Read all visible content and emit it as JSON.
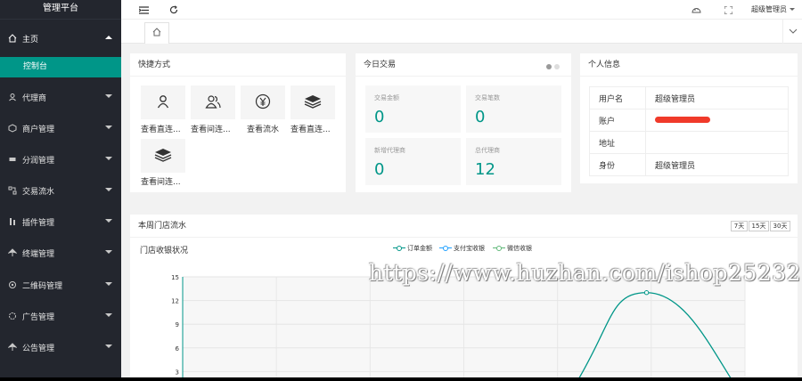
{
  "brand": "管理平台",
  "sidebar": {
    "items": [
      {
        "label": "主页",
        "icon": "home-icon"
      },
      {
        "label": "代理商",
        "icon": "user-icon"
      },
      {
        "label": "商户管理",
        "icon": "shop-icon"
      },
      {
        "label": "分润管理",
        "icon": "chat-icon"
      },
      {
        "label": "交易流水",
        "icon": "flow-icon"
      },
      {
        "label": "插件管理",
        "icon": "plugin-icon"
      },
      {
        "label": "终端管理",
        "icon": "terminal-icon"
      },
      {
        "label": "二维码管理",
        "icon": "qrcode-icon"
      },
      {
        "label": "广告管理",
        "icon": "ad-icon"
      },
      {
        "label": "公告管理",
        "icon": "notice-icon"
      }
    ],
    "active_sub": "控制台"
  },
  "header": {
    "user_name": "超级管理员"
  },
  "quick": {
    "title": "快捷方式",
    "items": [
      {
        "label": "查看直连...",
        "icon": "person-icon"
      },
      {
        "label": "查看间连...",
        "icon": "people-icon"
      },
      {
        "label": "查看流水",
        "icon": "yen-icon"
      },
      {
        "label": "查看直连...",
        "icon": "layers-icon"
      },
      {
        "label": "查看间连...",
        "icon": "layers-icon"
      }
    ]
  },
  "today": {
    "title": "今日交易",
    "stats": [
      {
        "label": "交易金额",
        "value": "0"
      },
      {
        "label": "交易笔数",
        "value": "0"
      },
      {
        "label": "新增代理商",
        "value": "0"
      },
      {
        "label": "总代理商",
        "value": "12"
      }
    ]
  },
  "profile": {
    "title": "个人信息",
    "rows": [
      {
        "key": "用户名",
        "value": "超级管理员"
      },
      {
        "key": "账户",
        "value": ""
      },
      {
        "key": "地址",
        "value": ""
      },
      {
        "key": "身份",
        "value": "超级管理员"
      }
    ]
  },
  "weekly": {
    "title": "本周门店流水",
    "subtitle": "门店收银状况",
    "ranges": [
      "7天",
      "15天",
      "30天"
    ]
  },
  "watermark": "https://www.huzhan.com/ishop25232",
  "colors": {
    "accent": "#009688",
    "sidebar_bg": "#23262e",
    "series_order": "#009688",
    "series_alipay": "#1e9fff",
    "series_wechat": "#5fb878"
  },
  "chart_data": {
    "type": "line",
    "title": "",
    "ylim": [
      0,
      15
    ],
    "yticks": [
      3,
      6,
      9,
      12,
      15
    ],
    "grid": true,
    "legend_position": "top-center",
    "series": [
      {
        "name": "订单金额",
        "color": "#009688"
      },
      {
        "name": "支付宝收银",
        "color": "#1e9fff"
      },
      {
        "name": "微信收银",
        "color": "#5fb878"
      }
    ],
    "peak_value": 13
  }
}
